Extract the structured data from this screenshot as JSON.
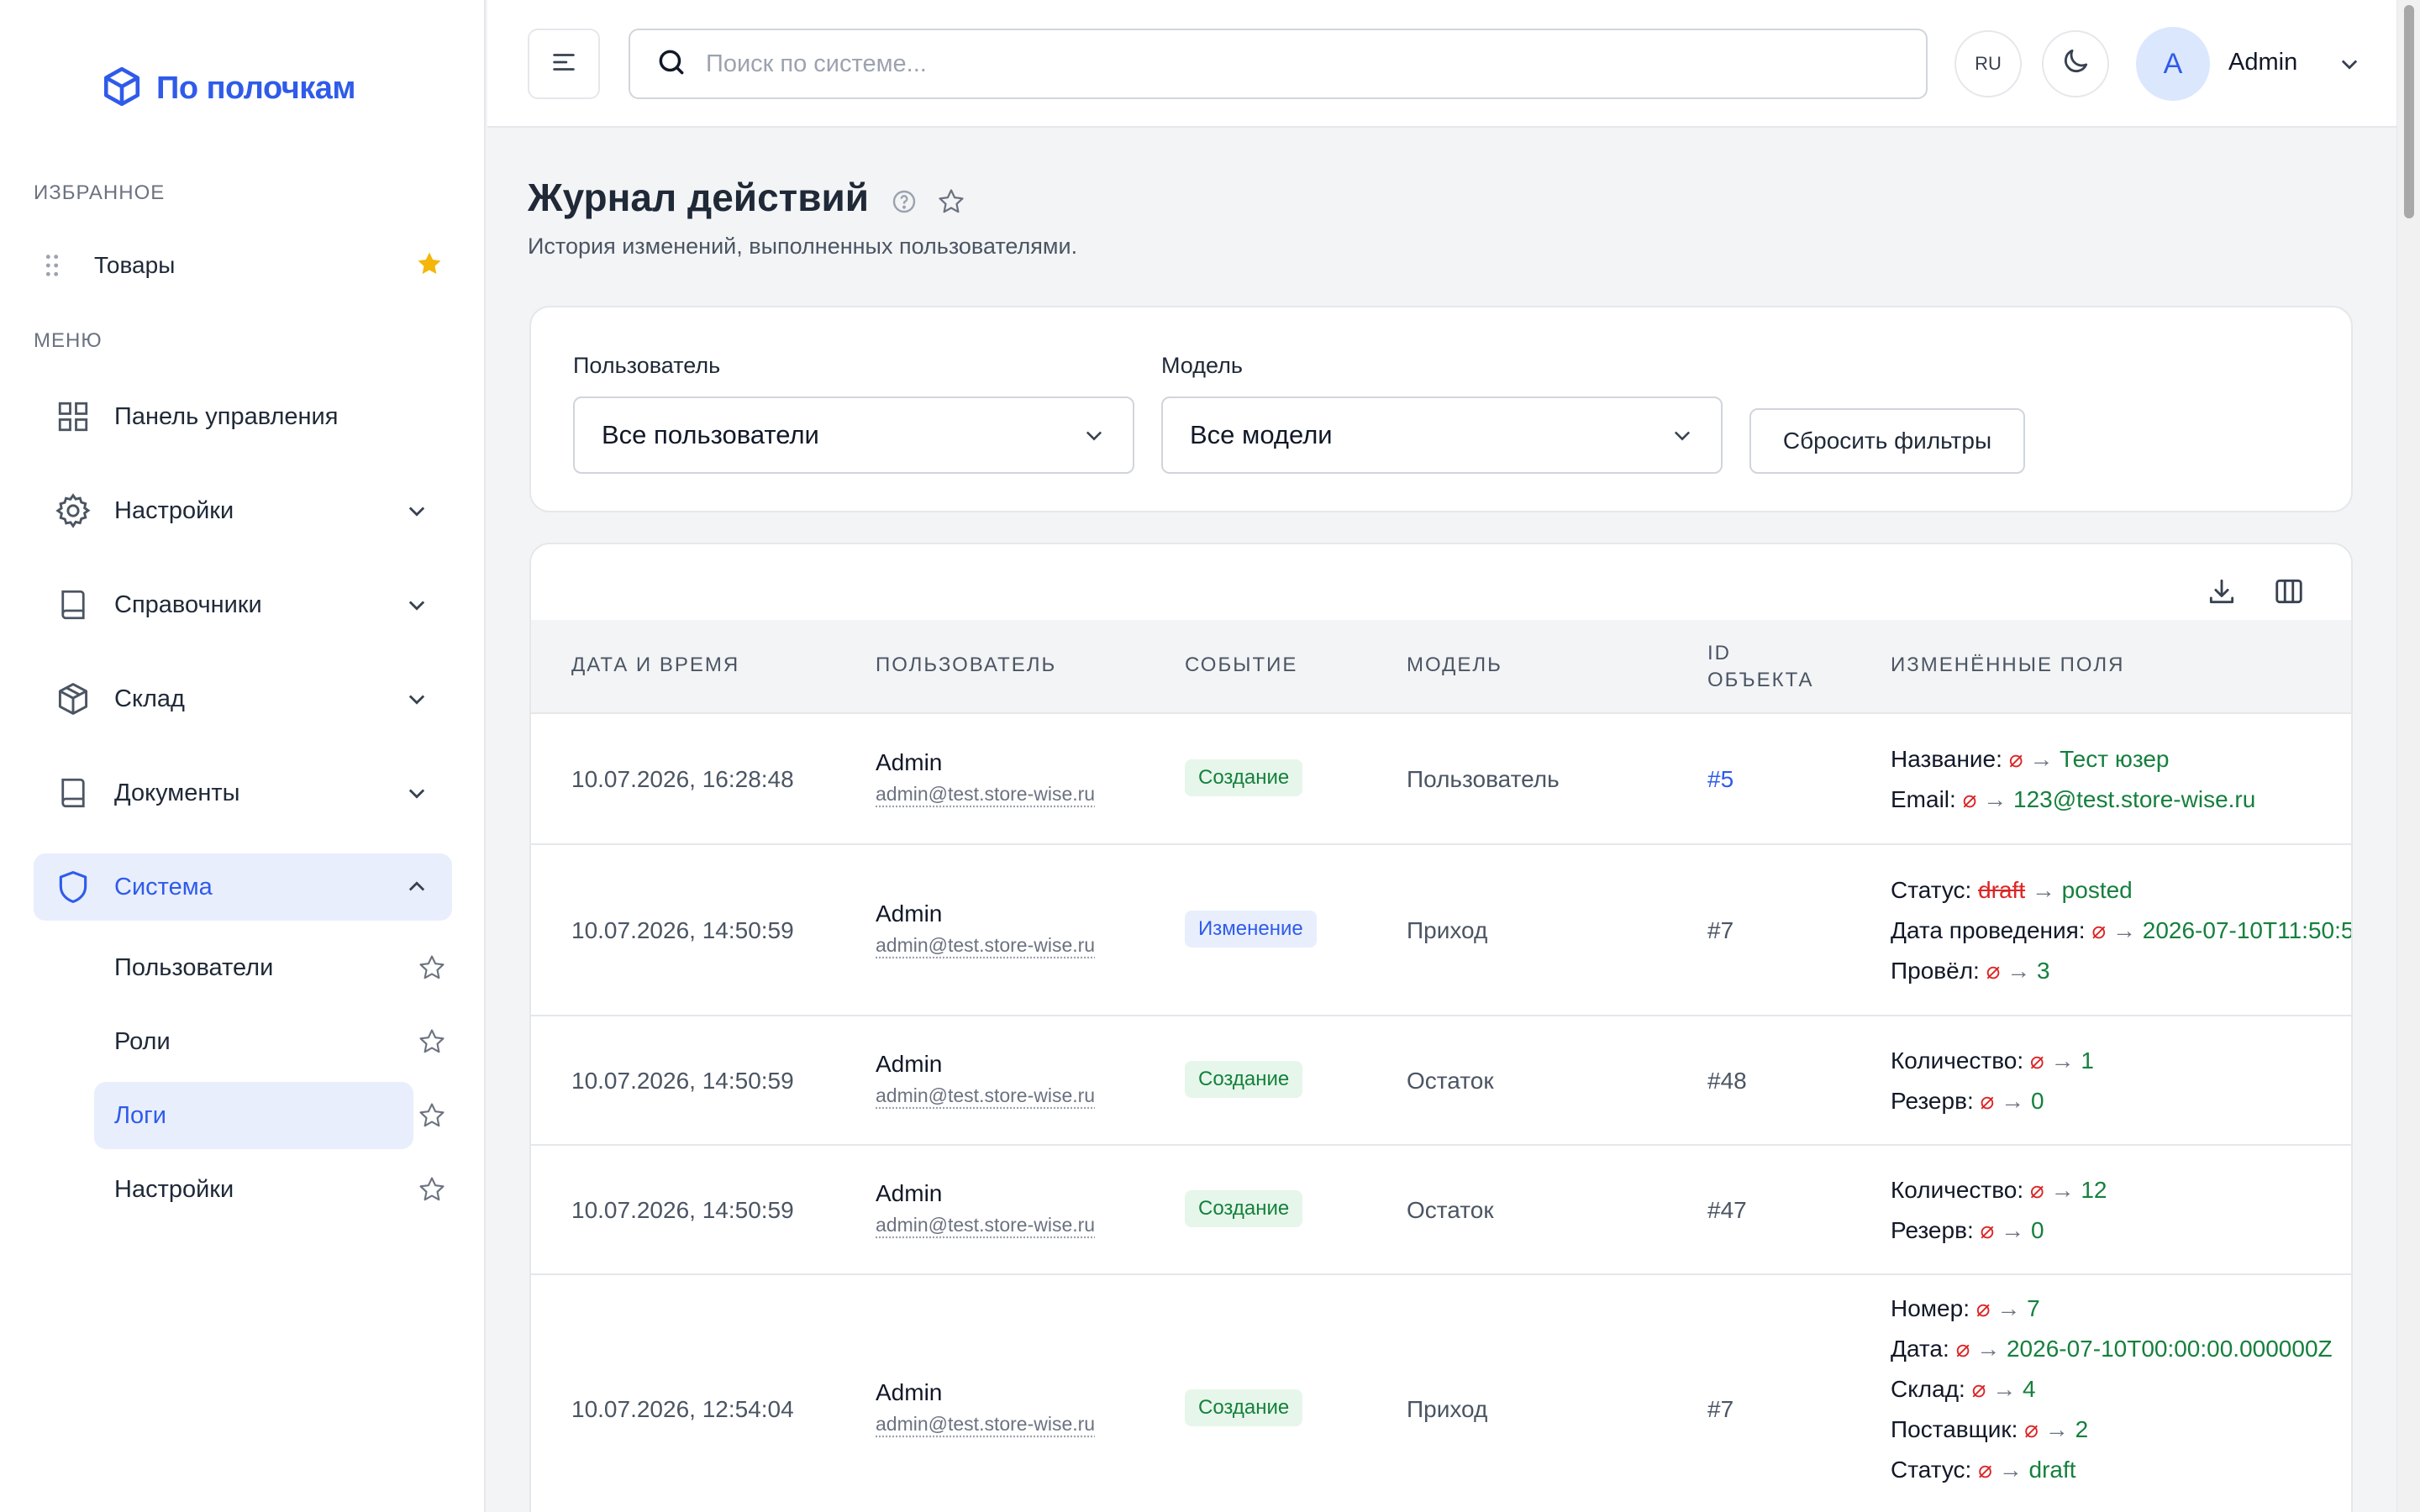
{
  "brand": {
    "name": "По полочкам",
    "color": "#2f5bea"
  },
  "sidebar": {
    "favorites_title": "ИЗБРАННОЕ",
    "favorites": [
      {
        "label": "Товары",
        "icon": "star-filled-icon"
      }
    ],
    "menu_title": "МЕНЮ",
    "items": [
      {
        "label": "Панель управления",
        "icon": "dashboard-grid-icon"
      },
      {
        "label": "Настройки",
        "icon": "gear-icon"
      },
      {
        "label": "Справочники",
        "icon": "book-icon"
      },
      {
        "label": "Склад",
        "icon": "box-icon"
      },
      {
        "label": "Документы",
        "icon": "document-book-icon"
      },
      {
        "label": "Система",
        "icon": "shield-icon",
        "expanded": true
      }
    ],
    "sub_items": [
      {
        "label": "Пользователи"
      },
      {
        "label": "Роли"
      },
      {
        "label": "Логи",
        "active": true
      },
      {
        "label": "Настройки"
      }
    ]
  },
  "topbar": {
    "search_placeholder": "Поиск по системе...",
    "lang": "RU",
    "avatar_letter": "A",
    "user_name": "Admin"
  },
  "page": {
    "title": "Журнал действий",
    "subtitle": "История изменений, выполненных пользователями."
  },
  "filters": {
    "user_label": "Пользователь",
    "user_value": "Все пользователи",
    "model_label": "Модель",
    "model_value": "Все модели",
    "reset_label": "Сбросить фильтры"
  },
  "table": {
    "columns": [
      "ДАТА И ВРЕМЯ",
      "ПОЛЬЗОВАТЕЛЬ",
      "СОБЫТИЕ",
      "МОДЕЛЬ",
      "ID",
      "ОБЪЕКТА",
      "ИЗМЕНЁННЫЕ ПОЛЯ"
    ],
    "empty_symbol": "⌀",
    "arrow": "→",
    "rows": [
      {
        "date": "10.07.2026, 16:28:48",
        "user": "Admin",
        "email": "admin@test.store-wise.ru",
        "event": "Создание",
        "model": "Пользователь",
        "object_id": "#5",
        "changes": [
          {
            "field": "Название:",
            "old": "",
            "new": "Тест юзер"
          },
          {
            "field": "Email:",
            "old": "",
            "new": "123@test.store-wise.ru"
          }
        ]
      },
      {
        "date": "10.07.2026, 14:50:59",
        "user": "Admin",
        "email": "admin@test.store-wise.ru",
        "event": "Изменение",
        "model": "Приход",
        "object_id": "#7",
        "changes": [
          {
            "field": "Статус:",
            "old": "draft",
            "new": "posted"
          },
          {
            "field": "Дата проведения:",
            "old": "",
            "new": "2026-07-10T11:50:5"
          },
          {
            "field": "Провёл:",
            "old": "",
            "new": "3"
          }
        ]
      },
      {
        "date": "10.07.2026, 14:50:59",
        "user": "Admin",
        "email": "admin@test.store-wise.ru",
        "event": "Создание",
        "model": "Остаток",
        "object_id": "#48",
        "changes": [
          {
            "field": "Количество:",
            "old": "",
            "new": "1"
          },
          {
            "field": "Резерв:",
            "old": "",
            "new": "0"
          }
        ]
      },
      {
        "date": "10.07.2026, 14:50:59",
        "user": "Admin",
        "email": "admin@test.store-wise.ru",
        "event": "Создание",
        "model": "Остаток",
        "object_id": "#47",
        "changes": [
          {
            "field": "Количество:",
            "old": "",
            "new": "12"
          },
          {
            "field": "Резерв:",
            "old": "",
            "new": "0"
          }
        ]
      },
      {
        "date": "10.07.2026, 12:54:04",
        "user": "Admin",
        "email": "admin@test.store-wise.ru",
        "event": "Создание",
        "model": "Приход",
        "object_id": "#7",
        "changes": [
          {
            "field": "Номер:",
            "old": "",
            "new": "7"
          },
          {
            "field": "Дата:",
            "old": "",
            "new": "2026-07-10T00:00:00.000000Z"
          },
          {
            "field": "Склад:",
            "old": "",
            "new": "4"
          },
          {
            "field": "Поставщик:",
            "old": "",
            "new": "2"
          },
          {
            "field": "Статус:",
            "old": "",
            "new": "draft"
          }
        ]
      }
    ]
  }
}
